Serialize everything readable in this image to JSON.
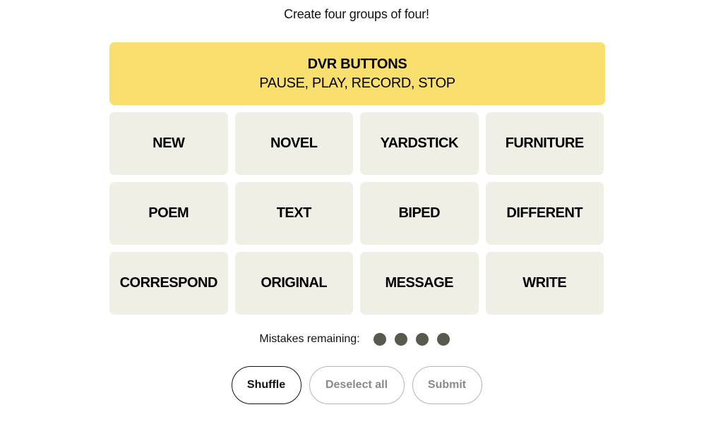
{
  "header": {
    "subtitle": "Create four groups of four!"
  },
  "solved_groups": [
    {
      "title": "DVR BUTTONS",
      "members": "PAUSE, PLAY, RECORD, STOP",
      "color": "#f9df6d"
    }
  ],
  "tiles": [
    {
      "label": "NEW"
    },
    {
      "label": "NOVEL"
    },
    {
      "label": "YARDSTICK"
    },
    {
      "label": "FURNITURE"
    },
    {
      "label": "POEM"
    },
    {
      "label": "TEXT"
    },
    {
      "label": "BIPED"
    },
    {
      "label": "DIFFERENT"
    },
    {
      "label": "CORRESPOND"
    },
    {
      "label": "ORIGINAL"
    },
    {
      "label": "MESSAGE"
    },
    {
      "label": "WRITE"
    }
  ],
  "mistakes": {
    "label": "Mistakes remaining:",
    "remaining": 4,
    "dot_color": "#5a594e"
  },
  "controls": {
    "shuffle_label": "Shuffle",
    "deselect_label": "Deselect all",
    "submit_label": "Submit"
  },
  "colors": {
    "tile_bg": "#efefe6",
    "yellow_group": "#f9df6d"
  }
}
